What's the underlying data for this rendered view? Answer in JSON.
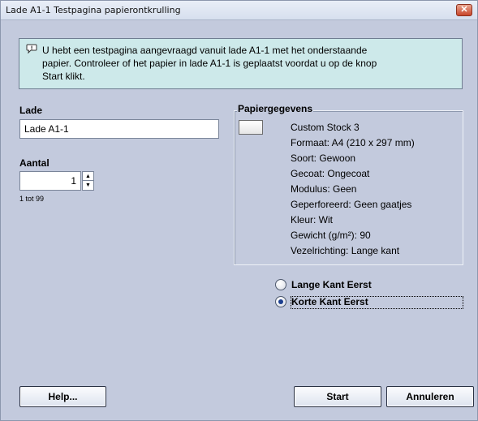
{
  "window": {
    "title": "Lade A1-1 Testpagina papierontkrulling",
    "close_symbol": "✕"
  },
  "info": {
    "icon": "speech-bubble-icon",
    "lines": [
      "U hebt een testpagina aangevraagd vanuit lade A1-1 met het onderstaande",
      "papier. Controleer of het papier in lade A1-1 is geplaatst voordat u op de knop",
      "Start klikt."
    ]
  },
  "tray": {
    "label": "Lade",
    "value": "Lade A1-1"
  },
  "quantity": {
    "label": "Aantal",
    "value": "1",
    "range_hint": "1 tot 99"
  },
  "paper_info": {
    "legend": "Papiergegevens",
    "details": [
      "Custom Stock 3",
      "Formaat: A4 (210 x 297 mm)",
      "Soort: Gewoon",
      "Gecoat: Ongecoat",
      "Modulus: Geen",
      "Geperforeerd: Geen gaatjes",
      "Kleur: Wit",
      "Gewicht (g/m²): 90",
      "Vezelrichting: Lange kant"
    ]
  },
  "orientation": {
    "options": [
      {
        "label": "Lange Kant Eerst",
        "selected": false
      },
      {
        "label": "Korte Kant Eerst",
        "selected": true
      }
    ]
  },
  "buttons": {
    "help": "Help...",
    "start": "Start",
    "cancel": "Annuleren"
  },
  "colors": {
    "dialog_bg": "#c3cadd",
    "info_bg": "#cde9ea",
    "close_button": "#c8452a"
  }
}
